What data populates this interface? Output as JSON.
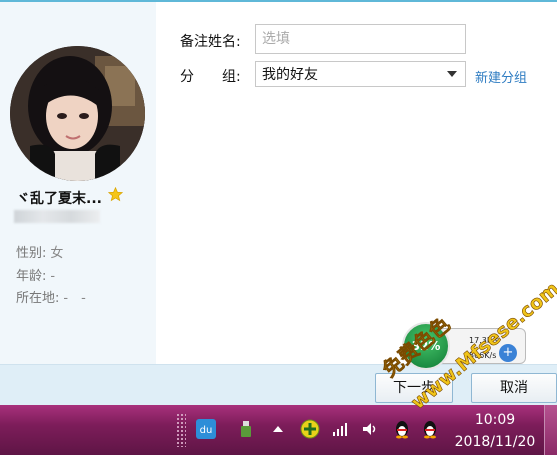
{
  "profile": {
    "nickname": "ヾ乱了夏末...",
    "gender_label": "性别:",
    "gender_value": "女",
    "age_label": "年龄:",
    "age_value": "-",
    "location_label": "所在地:",
    "location_value": "-　-"
  },
  "form": {
    "remark_label": "备注姓名:",
    "remark_placeholder": "选填",
    "group_label": "分　　组:",
    "group_selected": "我的好友",
    "new_group_link": "新建分组"
  },
  "buttons": {
    "next": "下一步",
    "cancel": "取消"
  },
  "speed_widget": {
    "percent": "32%",
    "upload": "17.3K/s",
    "download": "506K/s"
  },
  "taskbar": {
    "time": "10:09",
    "date": "2018/11/20"
  },
  "watermark": {
    "line1": "免费色色",
    "line2": "www.Mfsese.com"
  },
  "colors": {
    "accent": "#2e7cc2",
    "left_panel": "#f1f7fb",
    "footer": "#dfeef7",
    "taskbar": "#7d1d5a",
    "watermark": "#f0c419"
  }
}
